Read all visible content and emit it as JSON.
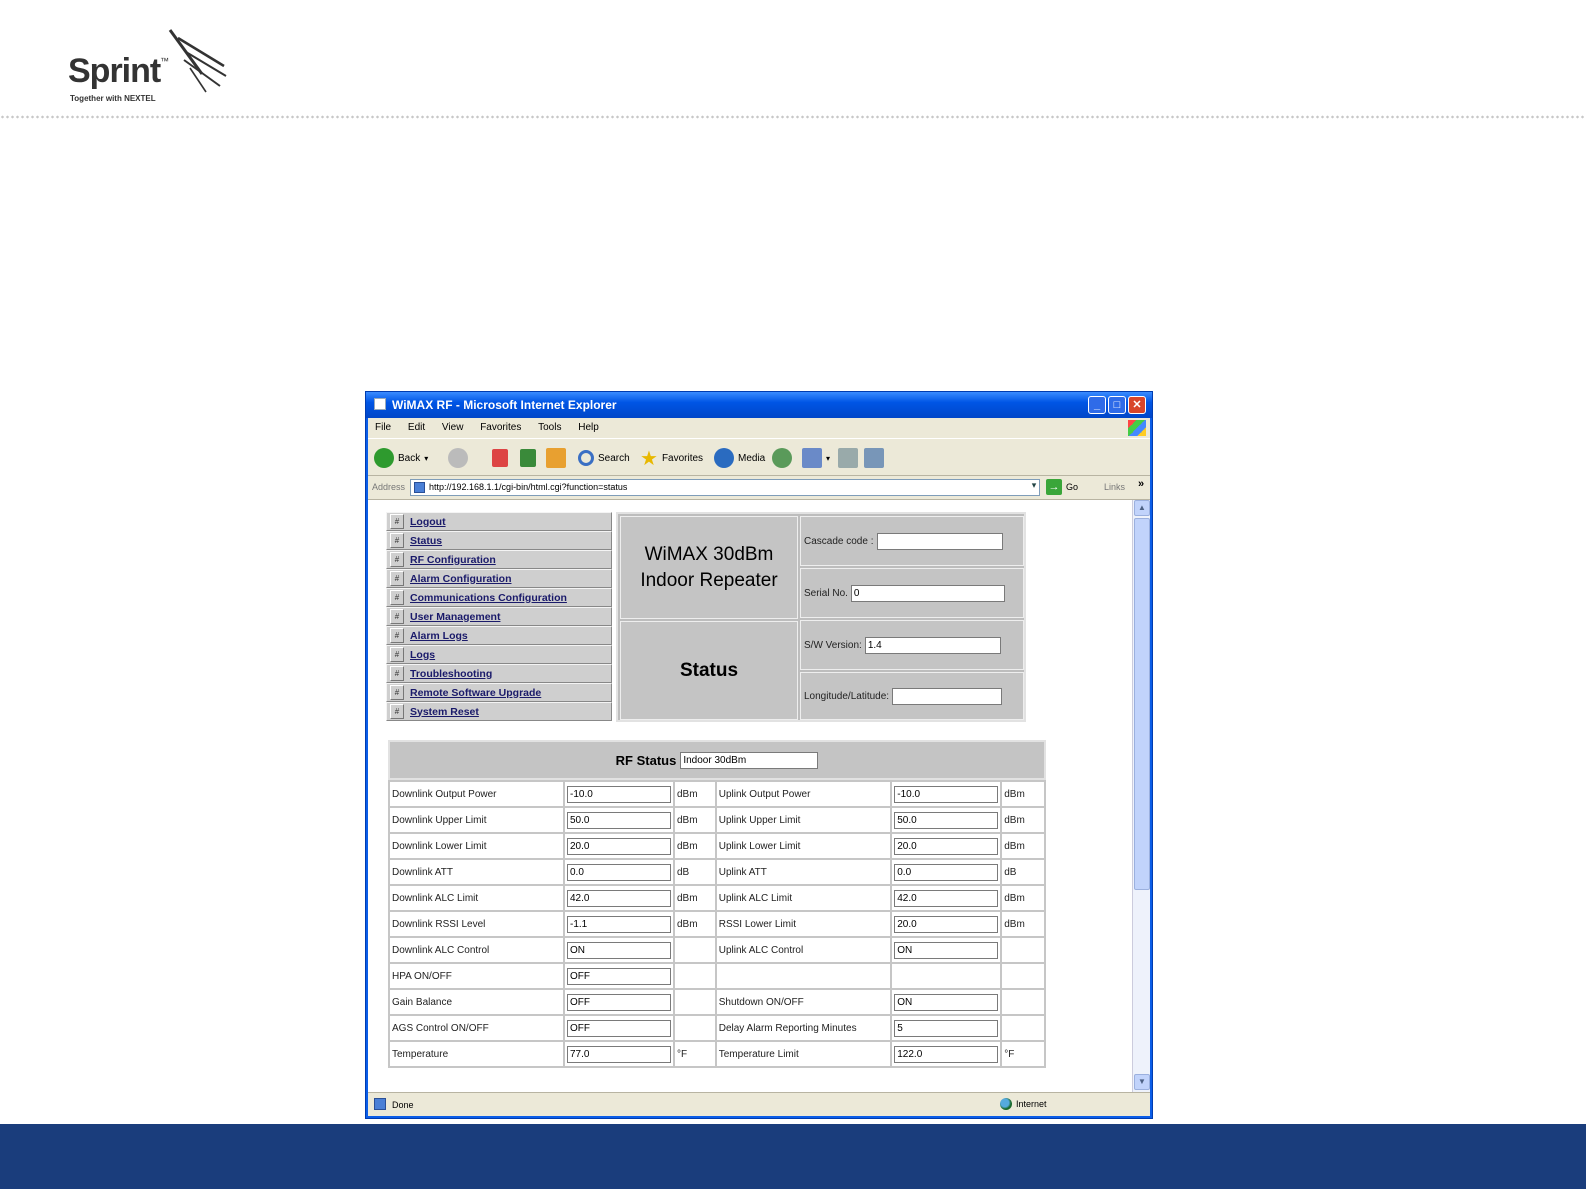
{
  "brand": {
    "name": "Sprint",
    "tagline": "Together with NEXTEL",
    "footer_color": "#1a3d7c"
  },
  "window": {
    "title": "WiMAX RF - Microsoft Internet Explorer",
    "controls": {
      "minimize": "_",
      "maximize": "□",
      "close": "✕"
    }
  },
  "menu": [
    "File",
    "Edit",
    "View",
    "Favorites",
    "Tools",
    "Help"
  ],
  "toolbar": {
    "back": "Back",
    "search": "Search",
    "favorites": "Favorites",
    "media": "Media",
    "icons": [
      "back-arrow-icon",
      "forward-arrow-icon",
      "stop-icon",
      "refresh-icon",
      "home-icon",
      "search-icon",
      "star-icon",
      "media-icon",
      "history-icon",
      "mail-icon",
      "print-icon",
      "edit-icon"
    ]
  },
  "address": {
    "label": "Address",
    "url": "http://192.168.1.1/cgi-bin/html.cgi?function=status",
    "go": "Go",
    "links": "Links"
  },
  "nav": [
    "Logout",
    "Status",
    "RF Configuration",
    "Alarm Configuration",
    "Communications Configuration",
    "User Management",
    "Alarm Logs",
    "Logs",
    "Troubleshooting",
    "Remote Software Upgrade",
    "System Reset"
  ],
  "header": {
    "title_line1": "WiMAX 30dBm",
    "title_line2": "Indoor Repeater",
    "page": "Status",
    "cascade_label": "Cascade code :",
    "cascade_value": "",
    "serial_label": "Serial No.",
    "serial_value": "0",
    "sw_label": "S/W Version:",
    "sw_value": "1.4",
    "lonlat_label": "Longitude/Latitude:",
    "lonlat_value": ""
  },
  "rf": {
    "title": "RF Status",
    "type_value": "Indoor 30dBm",
    "rows": [
      {
        "l_label": "Downlink Output Power",
        "l_value": "-10.0",
        "l_unit": "dBm",
        "r_label": "Uplink Output Power",
        "r_value": "-10.0",
        "r_unit": "dBm"
      },
      {
        "l_label": "Downlink Upper Limit",
        "l_value": "50.0",
        "l_unit": "dBm",
        "r_label": "Uplink Upper Limit",
        "r_value": "50.0",
        "r_unit": "dBm"
      },
      {
        "l_label": "Downlink Lower Limit",
        "l_value": "20.0",
        "l_unit": "dBm",
        "r_label": "Uplink Lower Limit",
        "r_value": "20.0",
        "r_unit": "dBm"
      },
      {
        "l_label": "Downlink ATT",
        "l_value": "0.0",
        "l_unit": "dB",
        "r_label": "Uplink ATT",
        "r_value": "0.0",
        "r_unit": "dB"
      },
      {
        "l_label": "Downlink ALC Limit",
        "l_value": "42.0",
        "l_unit": "dBm",
        "r_label": "Uplink ALC Limit",
        "r_value": "42.0",
        "r_unit": "dBm"
      },
      {
        "l_label": "Downlink RSSI Level",
        "l_value": "-1.1",
        "l_unit": "dBm",
        "r_label": "RSSI Lower Limit",
        "r_value": "20.0",
        "r_unit": "dBm"
      },
      {
        "l_label": "Downlink ALC Control",
        "l_value": "ON",
        "l_unit": "",
        "r_label": "Uplink ALC Control",
        "r_value": "ON",
        "r_unit": ""
      },
      {
        "l_label": "HPA ON/OFF",
        "l_value": "OFF",
        "l_unit": "",
        "r_label": "",
        "r_value": null,
        "r_unit": ""
      },
      {
        "l_label": "Gain Balance",
        "l_value": "OFF",
        "l_unit": "",
        "r_label": "Shutdown ON/OFF",
        "r_value": "ON",
        "r_unit": ""
      },
      {
        "l_label": "AGS Control ON/OFF",
        "l_value": "OFF",
        "l_unit": "",
        "r_label": "Delay Alarm Reporting Minutes",
        "r_value": "5",
        "r_unit": ""
      },
      {
        "l_label": "Temperature",
        "l_value": "77.0",
        "l_unit": "°F",
        "r_label": "Temperature Limit",
        "r_value": "122.0",
        "r_unit": "°F"
      }
    ]
  },
  "statusbar": {
    "text": "Done",
    "zone": "Internet"
  }
}
